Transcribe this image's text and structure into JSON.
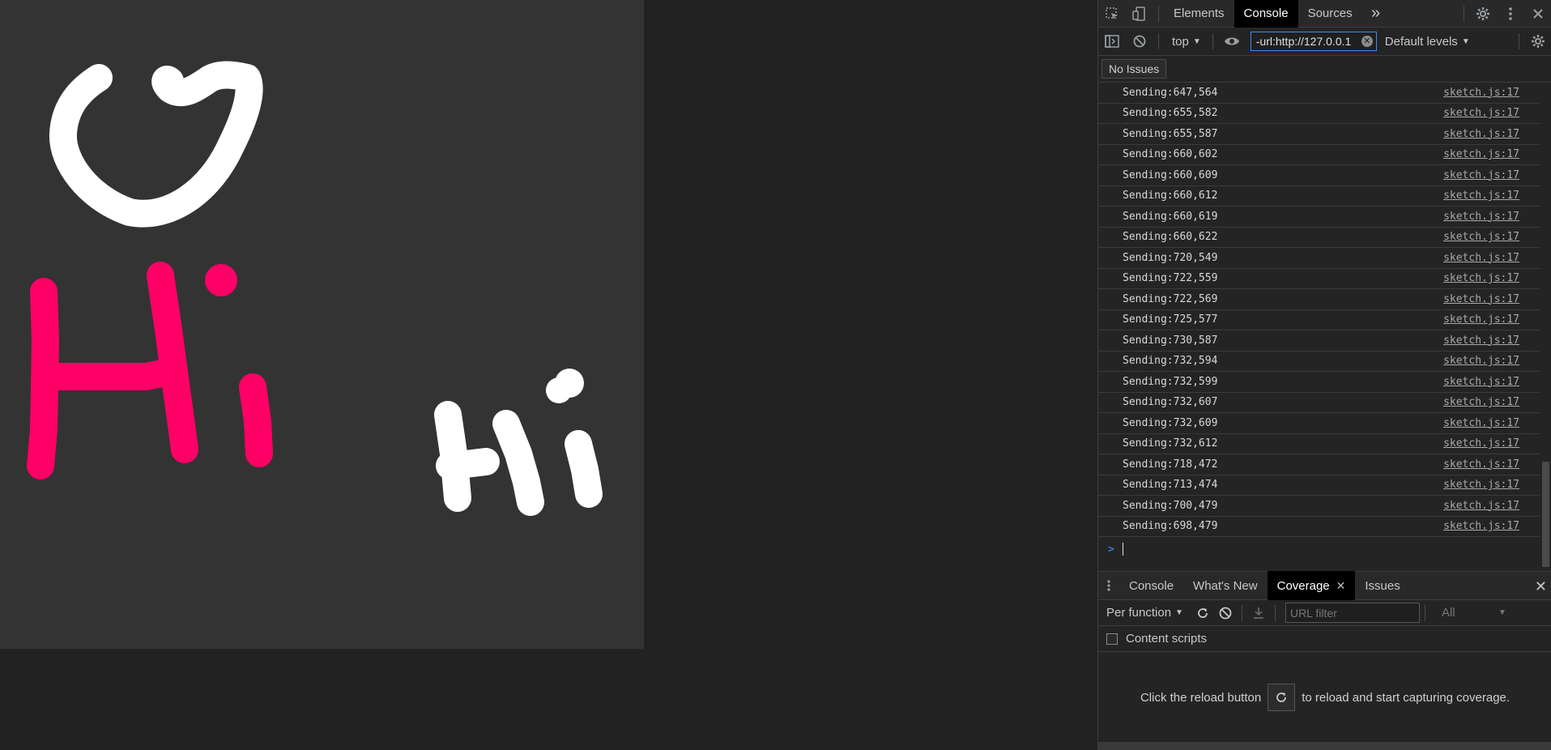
{
  "devtools": {
    "main_tabs": [
      {
        "label": "Elements",
        "active": false
      },
      {
        "label": "Console",
        "active": true
      },
      {
        "label": "Sources",
        "active": false
      }
    ],
    "more_tabs_glyph": "»",
    "console_toolbar": {
      "context": "top",
      "filter_value": "-url:http://127.0.0.1",
      "levels": "Default levels"
    },
    "issues_button": "No Issues",
    "log_rows": [
      {
        "msg": "Sending:647,564",
        "src": "sketch.js:17"
      },
      {
        "msg": "Sending:655,582",
        "src": "sketch.js:17"
      },
      {
        "msg": "Sending:655,587",
        "src": "sketch.js:17"
      },
      {
        "msg": "Sending:660,602",
        "src": "sketch.js:17"
      },
      {
        "msg": "Sending:660,609",
        "src": "sketch.js:17"
      },
      {
        "msg": "Sending:660,612",
        "src": "sketch.js:17"
      },
      {
        "msg": "Sending:660,619",
        "src": "sketch.js:17"
      },
      {
        "msg": "Sending:660,622",
        "src": "sketch.js:17"
      },
      {
        "msg": "Sending:720,549",
        "src": "sketch.js:17"
      },
      {
        "msg": "Sending:722,559",
        "src": "sketch.js:17"
      },
      {
        "msg": "Sending:722,569",
        "src": "sketch.js:17"
      },
      {
        "msg": "Sending:725,577",
        "src": "sketch.js:17"
      },
      {
        "msg": "Sending:730,587",
        "src": "sketch.js:17"
      },
      {
        "msg": "Sending:732,594",
        "src": "sketch.js:17"
      },
      {
        "msg": "Sending:732,599",
        "src": "sketch.js:17"
      },
      {
        "msg": "Sending:732,607",
        "src": "sketch.js:17"
      },
      {
        "msg": "Sending:732,609",
        "src": "sketch.js:17"
      },
      {
        "msg": "Sending:732,612",
        "src": "sketch.js:17"
      },
      {
        "msg": "Sending:718,472",
        "src": "sketch.js:17"
      },
      {
        "msg": "Sending:713,474",
        "src": "sketch.js:17"
      },
      {
        "msg": "Sending:700,479",
        "src": "sketch.js:17"
      },
      {
        "msg": "Sending:698,479",
        "src": "sketch.js:17"
      }
    ],
    "prompt_glyph": ">",
    "drawer": {
      "tabs": [
        {
          "label": "Console",
          "active": false
        },
        {
          "label": "What's New",
          "active": false
        },
        {
          "label": "Coverage",
          "active": true
        },
        {
          "label": "Issues",
          "active": false
        }
      ],
      "coverage": {
        "granularity": "Per function",
        "url_filter_placeholder": "URL filter",
        "type_filter": "All",
        "content_scripts_label": "Content scripts",
        "empty_before": "Click the reload button",
        "empty_after": "to reload and start capturing coverage."
      }
    }
  },
  "colors": {
    "canvas_background": "#333333",
    "page_background": "#222222",
    "stroke_white": "#ffffff",
    "stroke_pink": "#ff0066",
    "accent_blue": "#3f8ce8"
  }
}
